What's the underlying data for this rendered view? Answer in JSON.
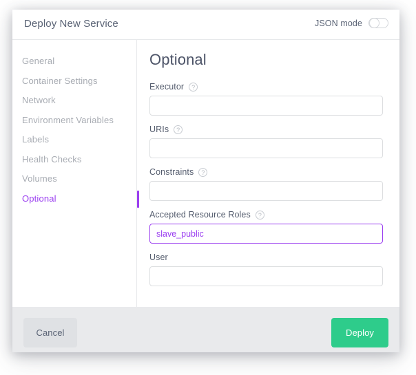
{
  "dialog": {
    "title": "Deploy New Service",
    "json_mode": {
      "label": "JSON mode",
      "enabled": false
    }
  },
  "sidebar": {
    "items": [
      {
        "label": "General",
        "active": false
      },
      {
        "label": "Container Settings",
        "active": false
      },
      {
        "label": "Network",
        "active": false
      },
      {
        "label": "Environment Variables",
        "active": false
      },
      {
        "label": "Labels",
        "active": false
      },
      {
        "label": "Health Checks",
        "active": false
      },
      {
        "label": "Volumes",
        "active": false
      },
      {
        "label": "Optional",
        "active": true
      }
    ]
  },
  "content": {
    "section_title": "Optional",
    "fields": [
      {
        "label": "Executor",
        "has_help": true,
        "value": "",
        "placeholder": "",
        "focused": false
      },
      {
        "label": "URIs",
        "has_help": true,
        "value": "",
        "placeholder": "",
        "focused": false
      },
      {
        "label": "Constraints",
        "has_help": true,
        "value": "",
        "placeholder": "",
        "focused": false
      },
      {
        "label": "Accepted Resource Roles",
        "has_help": true,
        "value": "slave_public",
        "placeholder": "",
        "focused": true
      },
      {
        "label": "User",
        "has_help": false,
        "value": "",
        "placeholder": "",
        "focused": false
      }
    ],
    "help_icon_glyph": "?"
  },
  "footer": {
    "cancel_label": "Cancel",
    "deploy_label": "Deploy"
  },
  "colors": {
    "accent_purple": "#9b3ff0",
    "deploy_green": "#2ecc8b",
    "cancel_gray": "#dfe1e4",
    "footer_bg": "#e9eaec",
    "label_text": "#555d6e",
    "muted_text": "#a8acb3"
  }
}
